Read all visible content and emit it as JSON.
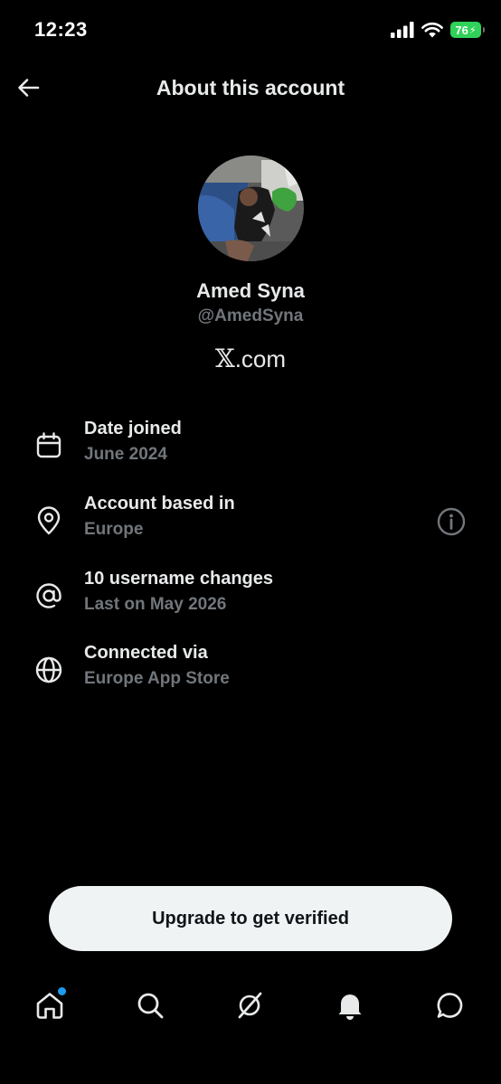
{
  "status_bar": {
    "time": "12:23",
    "battery": "76",
    "battery_color": "#30d158"
  },
  "header": {
    "title": "About this account",
    "back_icon": "arrow-left-icon"
  },
  "profile": {
    "name": "Amed Syna",
    "handle": "@AmedSyna",
    "brand": ".com",
    "brand_mark": "𝕏"
  },
  "info": [
    {
      "icon": "calendar-icon",
      "title": "Date joined",
      "subtitle": "June 2024"
    },
    {
      "icon": "location-pin-icon",
      "title": "Account based in",
      "subtitle": "Europe",
      "action_icon": "info-icon"
    },
    {
      "icon": "at-sign-icon",
      "title": "10 username changes",
      "subtitle": "Last on May 2026"
    },
    {
      "icon": "globe-icon",
      "title": "Connected via",
      "subtitle": "Europe App Store"
    }
  ],
  "cta": {
    "label": "Upgrade to get verified"
  },
  "bottom_nav": {
    "items": [
      "home-icon",
      "search-icon",
      "grok-icon",
      "notifications-bell-icon",
      "messages-icon"
    ],
    "accent": "#1d9bf0"
  },
  "colors": {
    "background": "#000000",
    "text_primary": "#e7e9ea",
    "text_secondary": "#71767b"
  }
}
